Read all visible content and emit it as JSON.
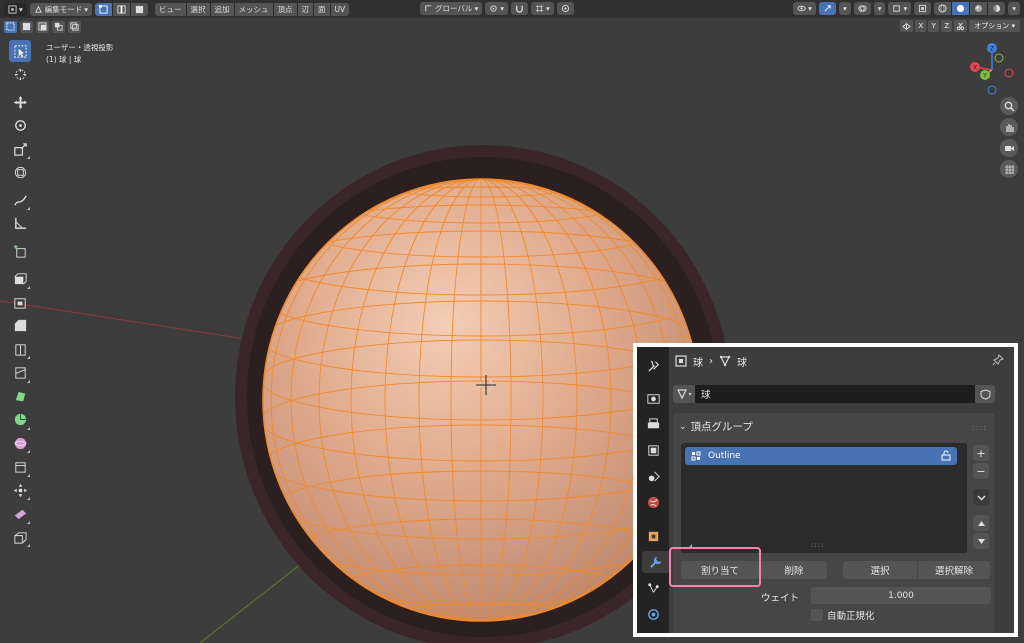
{
  "header": {
    "mode": "編集モード",
    "menus": [
      "ビュー",
      "選択",
      "追加",
      "メッシュ",
      "頂点",
      "辺",
      "面",
      "UV"
    ],
    "transform_orientation": "グローバル"
  },
  "subbar": {
    "axes": [
      "X",
      "Y",
      "Z"
    ],
    "options": "オプション"
  },
  "viewport": {
    "view_name": "ユーザー・透視投影",
    "object_info": "(1) 球 | 球"
  },
  "gizmo": {
    "x": "X",
    "y": "Y",
    "z": "Z",
    "x_color": "#e8454f",
    "y_color": "#7fbc39",
    "z_color": "#3d82e6"
  },
  "properties": {
    "breadcrumb": {
      "object": "球",
      "mesh": "球"
    },
    "mesh_name": "球",
    "panel_title": "頂点グループ",
    "groups": [
      {
        "name": "Outline"
      }
    ],
    "buttons": {
      "assign": "割り当て",
      "remove": "削除",
      "select": "選択",
      "deselect": "選択解除"
    },
    "weight_label": "ウェイト",
    "weight_value": "1.000",
    "auto_normalize": "自動正規化",
    "highlight_color": "#ff7fb0",
    "accent": "#4772b3"
  }
}
